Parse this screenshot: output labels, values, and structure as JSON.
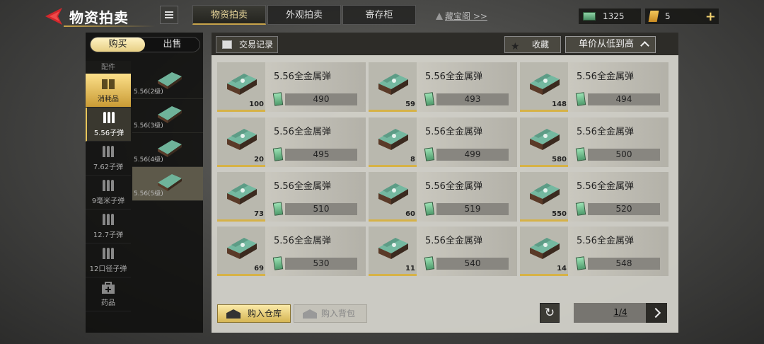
{
  "header": {
    "title": "物资拍卖",
    "tabs": [
      {
        "label": "物资拍卖",
        "active": true
      },
      {
        "label": "外观拍卖",
        "active": false
      },
      {
        "label": "寄存柜",
        "active": false
      }
    ],
    "treasure_link": "藏宝阁 >>",
    "money": "1325",
    "tickets": "5",
    "plus": "+"
  },
  "sidebar": {
    "mode_buy": "购买",
    "mode_sell": "出售",
    "category_header": "配件",
    "categories": [
      {
        "label": "消耗品",
        "icon": "consumable-icon"
      },
      {
        "label": "5.56子弹",
        "icon": "bullets-icon"
      },
      {
        "label": "7.62子弹",
        "icon": "bullets-icon"
      },
      {
        "label": "9毫米子弹",
        "icon": "bullets-icon"
      },
      {
        "label": "12.7子弹",
        "icon": "bullets-icon"
      },
      {
        "label": "12口径子弹",
        "icon": "bullets-icon"
      },
      {
        "label": "药品",
        "icon": "medkit-icon"
      }
    ],
    "subitems": [
      {
        "label": "5.56(2级)"
      },
      {
        "label": "5.56(3级)"
      },
      {
        "label": "5.56(4级)"
      },
      {
        "label": "5.56(5级)"
      }
    ]
  },
  "toolbar": {
    "records": "交易记录",
    "favorite": "收藏",
    "sort": "单价从低到高"
  },
  "listings": [
    {
      "name": "5.56全金属弹",
      "qty": "100",
      "price": "490"
    },
    {
      "name": "5.56全金属弹",
      "qty": "59",
      "price": "493"
    },
    {
      "name": "5.56全金属弹",
      "qty": "148",
      "price": "494"
    },
    {
      "name": "5.56全金属弹",
      "qty": "20",
      "price": "495"
    },
    {
      "name": "5.56全金属弹",
      "qty": "8",
      "price": "499"
    },
    {
      "name": "5.56全金属弹",
      "qty": "580",
      "price": "500"
    },
    {
      "name": "5.56全金属弹",
      "qty": "73",
      "price": "510"
    },
    {
      "name": "5.56全金属弹",
      "qty": "60",
      "price": "519"
    },
    {
      "name": "5.56全金属弹",
      "qty": "550",
      "price": "520"
    },
    {
      "name": "5.56全金属弹",
      "qty": "69",
      "price": "530"
    },
    {
      "name": "5.56全金属弹",
      "qty": "11",
      "price": "540"
    },
    {
      "name": "5.56全金属弹",
      "qty": "14",
      "price": "548"
    }
  ],
  "footer": {
    "buy_warehouse": "购入仓库",
    "buy_backpack": "购入背包",
    "page": "1/4"
  }
}
